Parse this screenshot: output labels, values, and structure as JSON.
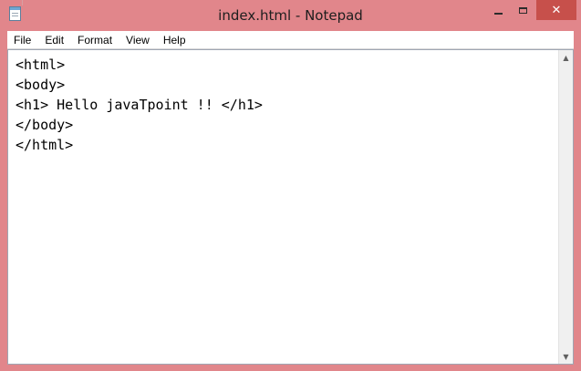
{
  "window": {
    "title": "index.html - Notepad",
    "close_glyph": "✕"
  },
  "menu": {
    "items": [
      "File",
      "Edit",
      "Format",
      "View",
      "Help"
    ]
  },
  "editor": {
    "lines": [
      "<html>",
      "<body>",
      "<h1> Hello javaTpoint !! </h1>",
      "</body>",
      "</html>"
    ]
  },
  "scrollbar": {
    "up_glyph": "▲",
    "down_glyph": "▼"
  },
  "colors": {
    "frame": "#e1868b",
    "close_button": "#c7504b",
    "editor_bg": "#ffffff"
  }
}
